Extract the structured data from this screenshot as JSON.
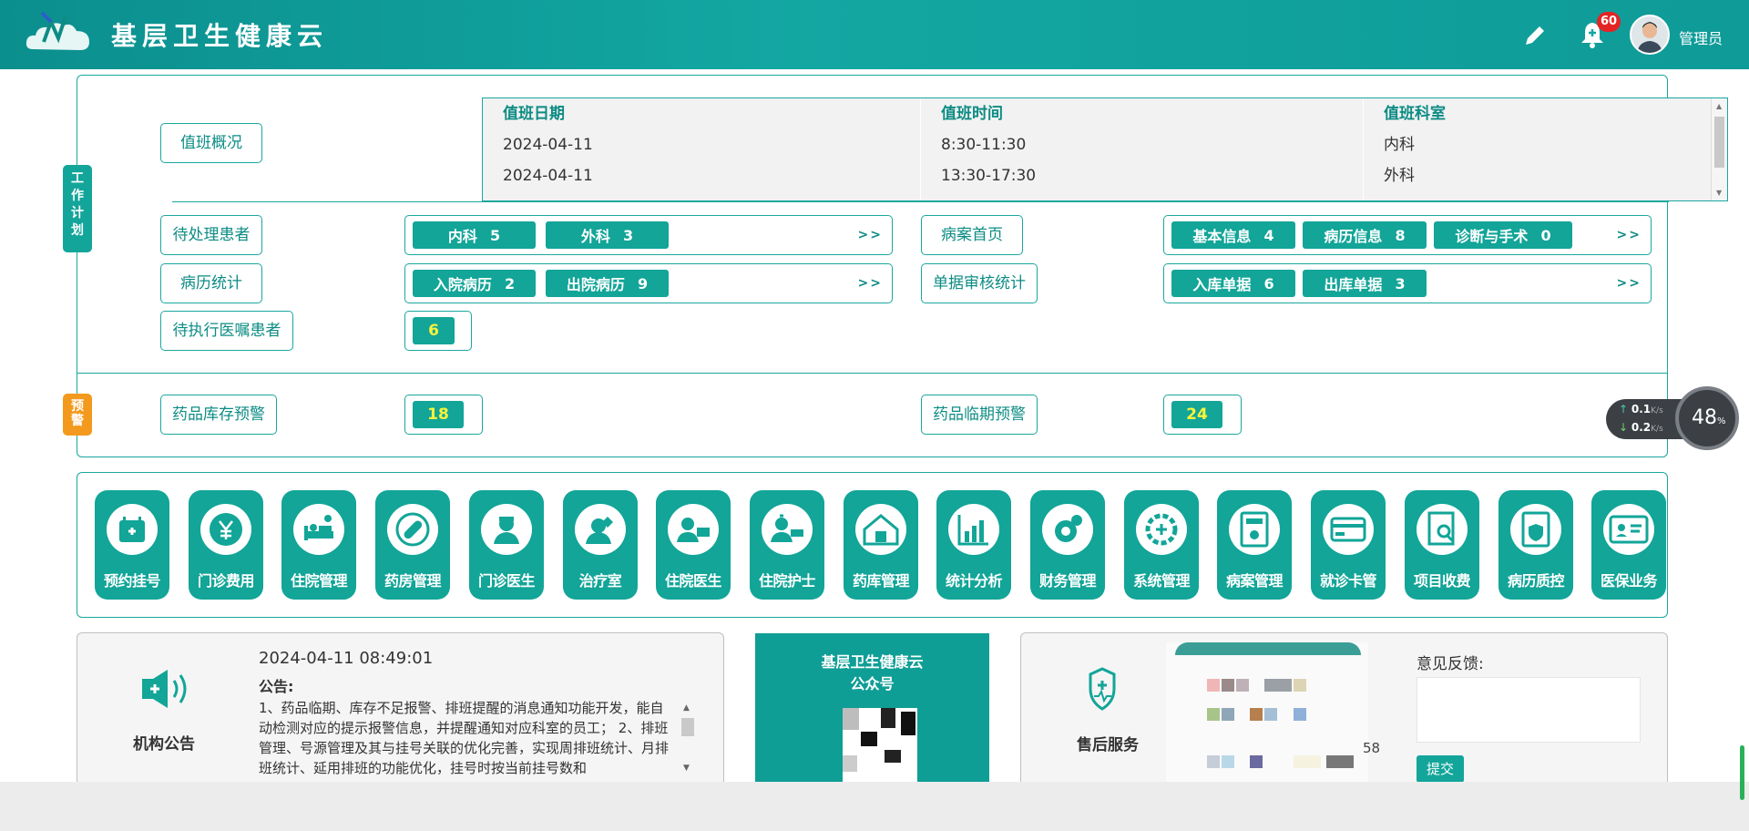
{
  "header": {
    "app_title": "基层卫生健康云",
    "notification_count": "60",
    "user_name": "管理员"
  },
  "work_plan": {
    "tag": "工作计划",
    "duty": {
      "label": "值班概况",
      "columns": [
        "值班日期",
        "值班时间",
        "值班科室"
      ],
      "rows": [
        [
          "2024-04-11",
          "8:30-11:30",
          "内科"
        ],
        [
          "2024-04-11",
          "13:30-17:30",
          "外科"
        ]
      ]
    },
    "pending_patients": {
      "label": "待处理患者",
      "items": [
        {
          "name": "内科",
          "count": "5"
        },
        {
          "name": "外科",
          "count": "3"
        }
      ],
      "more": ">>"
    },
    "case_home": {
      "label": "病案首页",
      "items": [
        {
          "name": "基本信息",
          "count": "4"
        },
        {
          "name": "病历信息",
          "count": "8"
        },
        {
          "name": "诊断与手术",
          "count": "0"
        }
      ],
      "more": ">>"
    },
    "record_stats": {
      "label": "病历统计",
      "items": [
        {
          "name": "入院病历",
          "count": "2"
        },
        {
          "name": "出院病历",
          "count": "9"
        }
      ],
      "more": ">>"
    },
    "doc_audit": {
      "label": "单据审核统计",
      "items": [
        {
          "name": "入库单据",
          "count": "6"
        },
        {
          "name": "出库单据",
          "count": "3"
        }
      ],
      "more": ">>"
    },
    "pending_orders": {
      "label": "待执行医嘱患者",
      "count": "6"
    }
  },
  "warning": {
    "tag": "预警",
    "stock": {
      "label": "药品库存预警",
      "count": "18"
    },
    "expiry": {
      "label": "药品临期预警",
      "count": "24"
    }
  },
  "modules": [
    {
      "label": "预约挂号",
      "icon": "calendar-plus-icon"
    },
    {
      "label": "门诊费用",
      "icon": "yen-icon"
    },
    {
      "label": "住院管理",
      "icon": "bed-icon"
    },
    {
      "label": "药房管理",
      "icon": "pill-icon"
    },
    {
      "label": "门诊医生",
      "icon": "doctor-icon"
    },
    {
      "label": "治疗室",
      "icon": "nurse-icon"
    },
    {
      "label": "住院医生",
      "icon": "doctor-desk-icon"
    },
    {
      "label": "住院护士",
      "icon": "nurse-desk-icon"
    },
    {
      "label": "药库管理",
      "icon": "warehouse-icon"
    },
    {
      "label": "统计分析",
      "icon": "bar-chart-icon"
    },
    {
      "label": "财务管理",
      "icon": "finance-gear-icon"
    },
    {
      "label": "系统管理",
      "icon": "gear-plus-icon"
    },
    {
      "label": "病案管理",
      "icon": "case-file-icon"
    },
    {
      "label": "就诊卡管",
      "icon": "card-icon"
    },
    {
      "label": "项目收费",
      "icon": "invoice-search-icon"
    },
    {
      "label": "病历质控",
      "icon": "shield-doc-icon"
    },
    {
      "label": "医保业务",
      "icon": "id-card-icon"
    }
  ],
  "announcement": {
    "title": "机构公告",
    "time": "2024-04-11 08:49:01",
    "heading": "公告:",
    "body": "1、药品临期、库存不足报警、排班提醒的消息通知功能开发，能自动检测对应的提示报警信息，并提醒通知对应科室的员工； 2、排班管理、号源管理及其与挂号关联的优化完善，实现周排班统计、月排班统计、延用排班的功能优化，挂号时按当前挂号数和"
  },
  "wechat": {
    "title_line1": "基层卫生健康云",
    "title_line2": "公众号"
  },
  "after_sales": {
    "title": "售后服务",
    "partial_number": "58"
  },
  "feedback": {
    "label": "意见反馈:",
    "submit": "提交"
  },
  "net_widget": {
    "up": "0.1",
    "down": "0.2",
    "unit": "K/s",
    "percent": "48",
    "percent_unit": "%"
  }
}
